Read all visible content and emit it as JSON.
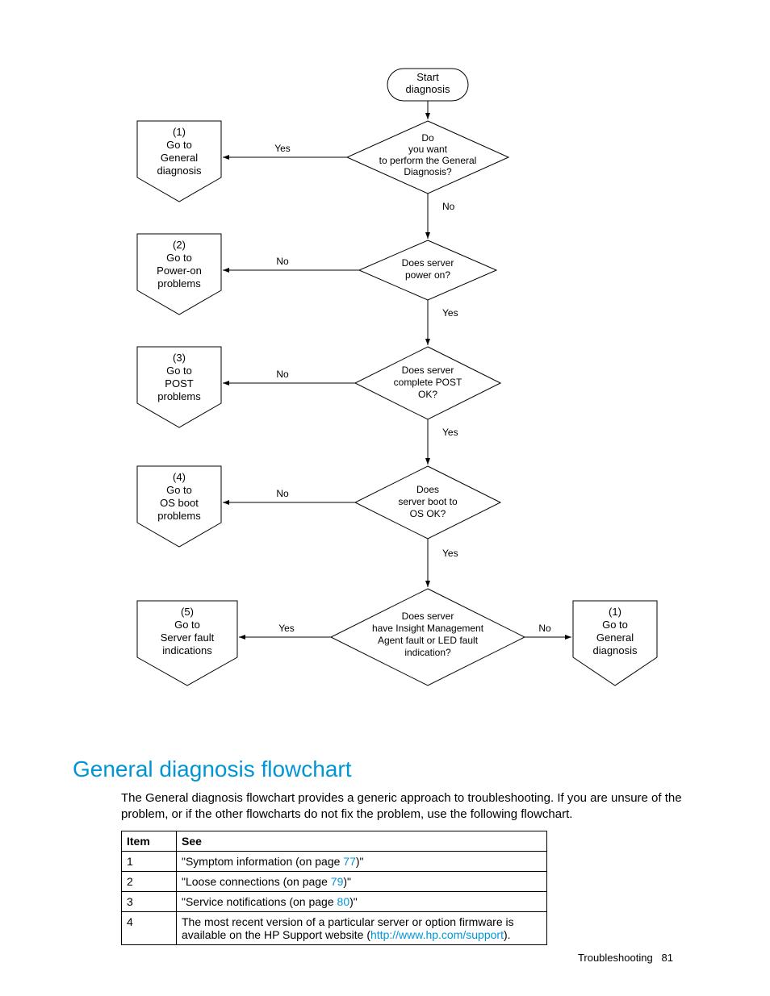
{
  "flowchart": {
    "start": "Start\ndiagnosis",
    "decisions": [
      {
        "q": "Do\nyou want\nto perform the General\nDiagnosis?",
        "yes": "Yes",
        "no": "No"
      },
      {
        "q": "Does server\npower on?",
        "yes": "Yes",
        "no": "No"
      },
      {
        "q": "Does server\ncomplete POST\nOK?",
        "yes": "Yes",
        "no": "No"
      },
      {
        "q": "Does\nserver boot to\nOS OK?",
        "yes": "Yes",
        "no": "No"
      },
      {
        "q": "Does server\nhave Insight Management\nAgent fault or LED fault\nindication?",
        "yes": "Yes",
        "no": "No"
      }
    ],
    "offpage": [
      {
        "t": "(1)\nGo to\nGeneral\ndiagnosis"
      },
      {
        "t": "(2)\nGo to\nPower-on\nproblems"
      },
      {
        "t": "(3)\nGo to\nPOST\nproblems"
      },
      {
        "t": "(4)\nGo to\nOS boot\nproblems"
      },
      {
        "t": "(5)\nGo to\nServer fault\nindications"
      },
      {
        "t": "(1)\nGo to\nGeneral\ndiagnosis"
      }
    ]
  },
  "heading": "General diagnosis flowchart",
  "body": "The General diagnosis flowchart provides a generic approach to troubleshooting. If you are unsure of the problem, or if the other flowcharts do not fix the problem, use the following flowchart.",
  "table": {
    "headers": [
      "Item",
      "See"
    ],
    "rows": [
      {
        "item": "1",
        "see_pre": "\"Symptom information (on page ",
        "link": "77",
        "see_post": ")\""
      },
      {
        "item": "2",
        "see_pre": "\"Loose connections (on page ",
        "link": "79",
        "see_post": ")\""
      },
      {
        "item": "3",
        "see_pre": "\"Service notifications (on page ",
        "link": "80",
        "see_post": ")\""
      },
      {
        "item": "4",
        "see_pre": "The most recent version of a particular server or option firmware is available on the HP Support website (",
        "link": "http://www.hp.com/support",
        "see_post": ")."
      }
    ]
  },
  "footer_label": "Troubleshooting",
  "footer_page": "81"
}
